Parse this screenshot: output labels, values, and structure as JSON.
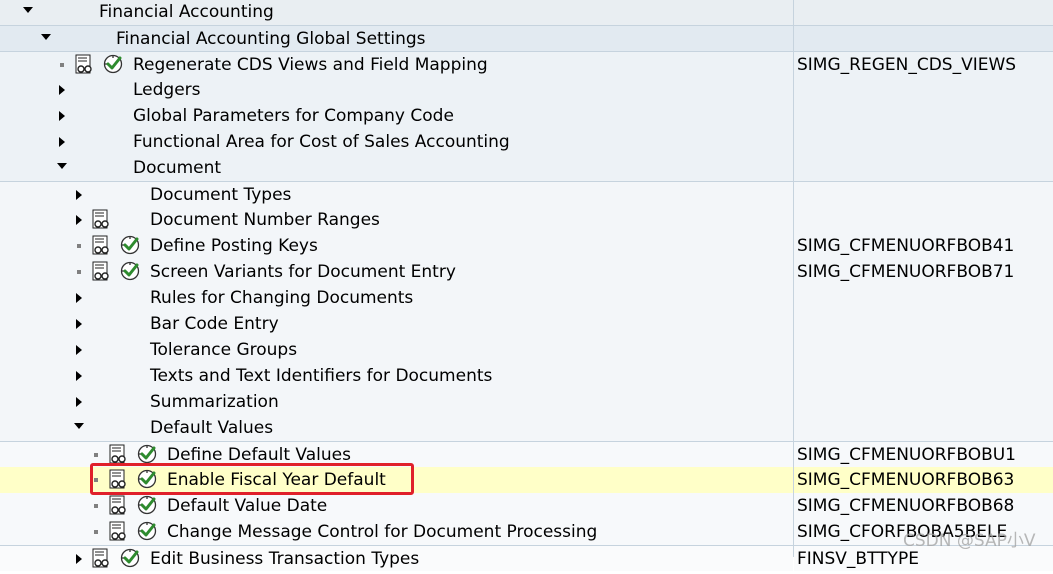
{
  "tree": {
    "rows": [
      {
        "level": 0,
        "expand": "down",
        "label": "Financial Accounting",
        "code": "",
        "bg": "bg0",
        "divider": false
      },
      {
        "level": 1,
        "expand": "down",
        "label": "Financial Accounting Global Settings",
        "code": "",
        "bg": "bg1",
        "divider": true
      },
      {
        "level": 2,
        "expand": "none",
        "doc": true,
        "exec": true,
        "label": "Regenerate CDS Views and Field Mapping",
        "code": "SIMG_REGEN_CDS_VIEWS",
        "bg": "bg2",
        "divider": true
      },
      {
        "level": 2,
        "expand": "right",
        "label": "Ledgers",
        "code": "",
        "bg": "bg2",
        "divider": false
      },
      {
        "level": 2,
        "expand": "right",
        "label": "Global Parameters for Company Code",
        "code": "",
        "bg": "bg2",
        "divider": false
      },
      {
        "level": 2,
        "expand": "right",
        "label": "Functional Area for Cost of Sales Accounting",
        "code": "",
        "bg": "bg2",
        "divider": false
      },
      {
        "level": 2,
        "expand": "down",
        "label": "Document",
        "code": "",
        "bg": "bg2",
        "divider": false
      },
      {
        "level": 3,
        "expand": "right",
        "label": "Document Types",
        "code": "",
        "bg": "bg3",
        "divider": true
      },
      {
        "level": 3,
        "expand": "right",
        "doc": true,
        "label": "Document Number Ranges",
        "code": "",
        "bg": "bg3",
        "divider": false
      },
      {
        "level": 3,
        "expand": "none",
        "doc": true,
        "exec": true,
        "label": "Define Posting Keys",
        "code": "SIMG_CFMENUORFBOB41",
        "bg": "bg3",
        "divider": false
      },
      {
        "level": 3,
        "expand": "none",
        "doc": true,
        "exec": true,
        "label": "Screen Variants for Document Entry",
        "code": "SIMG_CFMENUORFBOB71",
        "bg": "bg3",
        "divider": false
      },
      {
        "level": 3,
        "expand": "right",
        "label": "Rules for Changing Documents",
        "code": "",
        "bg": "bg3",
        "divider": false
      },
      {
        "level": 3,
        "expand": "right",
        "label": "Bar Code Entry",
        "code": "",
        "bg": "bg3",
        "divider": false
      },
      {
        "level": 3,
        "expand": "right",
        "label": "Tolerance Groups",
        "code": "",
        "bg": "bg3",
        "divider": false
      },
      {
        "level": 3,
        "expand": "right",
        "label": "Texts and Text Identifiers for Documents",
        "code": "",
        "bg": "bg3",
        "divider": false
      },
      {
        "level": 3,
        "expand": "right",
        "label": "Summarization",
        "code": "",
        "bg": "bg3",
        "divider": false
      },
      {
        "level": 3,
        "expand": "down",
        "label": "Default Values",
        "code": "",
        "bg": "bg3",
        "divider": false
      },
      {
        "level": 4,
        "expand": "none",
        "doc": true,
        "exec": true,
        "label": "Define Default Values",
        "code": "SIMG_CFMENUORFBOBU1",
        "bg": "bg4",
        "divider": true
      },
      {
        "level": 4,
        "expand": "none",
        "doc": true,
        "exec": true,
        "label": "Enable Fiscal Year Default",
        "code": "SIMG_CFMENUORFBOB63",
        "bg": "bg4",
        "divider": false,
        "selected": true
      },
      {
        "level": 4,
        "expand": "none",
        "doc": true,
        "exec": true,
        "label": "Default Value Date",
        "code": "SIMG_CFMENUORFBOB68",
        "bg": "bg4",
        "divider": false
      },
      {
        "level": 4,
        "expand": "none",
        "doc": true,
        "exec": true,
        "label": "Change Message Control for Document Processing",
        "code": "SIMG_CFORFBOBA5BELE",
        "bg": "bg4",
        "divider": false
      },
      {
        "level": 3,
        "expand": "right",
        "doc": true,
        "exec": true,
        "label": "Edit Business Transaction Types",
        "code": "FINSV_BTTYPE",
        "bg": "bg5",
        "divider": true
      }
    ]
  },
  "watermark": "CSDN @SAP小V",
  "colors": {
    "highlight_border": "#e0202a",
    "selected_row": "#ffffc8",
    "exec_green": "#2e8b2e"
  }
}
